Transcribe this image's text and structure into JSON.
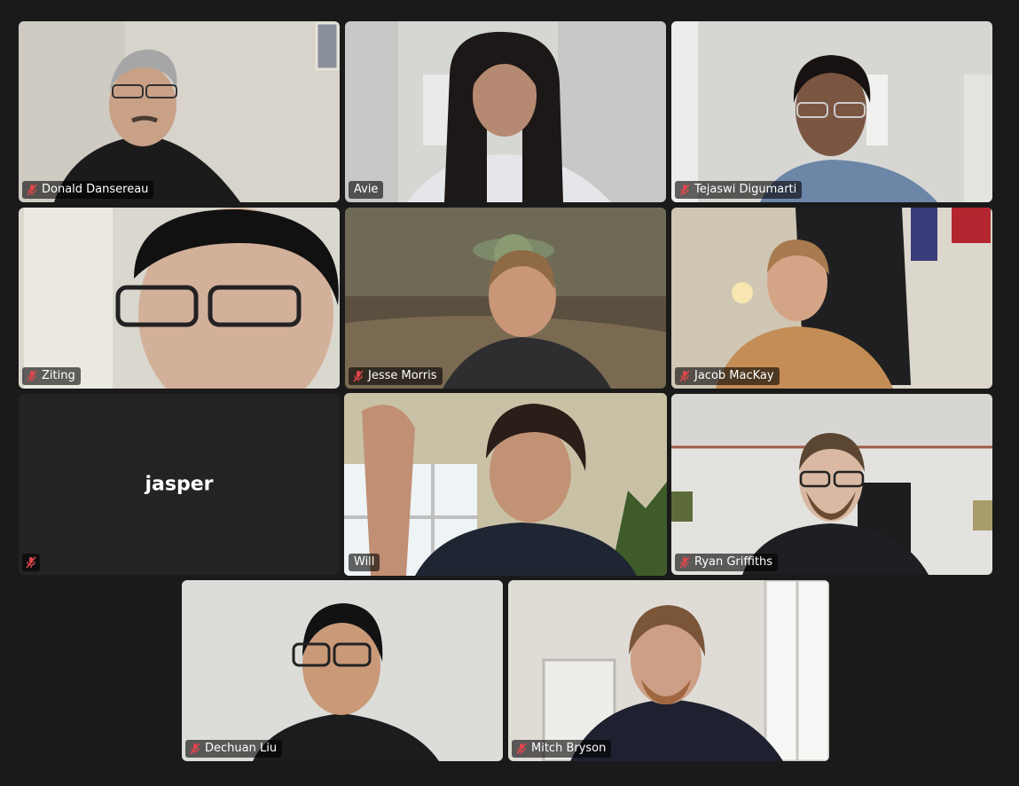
{
  "meeting": {
    "participants": [
      {
        "name": "Donald Dansereau",
        "muted": true,
        "video": true,
        "active": false
      },
      {
        "name": "Avie",
        "muted": false,
        "video": true,
        "active": false
      },
      {
        "name": "Tejaswi Digumarti",
        "muted": true,
        "video": true,
        "active": false
      },
      {
        "name": "Ziting",
        "muted": true,
        "video": true,
        "active": false
      },
      {
        "name": "Jesse Morris",
        "muted": true,
        "video": true,
        "active": false
      },
      {
        "name": "Jacob MacKay",
        "muted": true,
        "video": true,
        "active": false
      },
      {
        "name": "jasper",
        "muted": true,
        "video": false,
        "active": false
      },
      {
        "name": "Will",
        "muted": false,
        "video": true,
        "active": true
      },
      {
        "name": "Ryan Griffiths",
        "muted": true,
        "video": true,
        "active": false
      },
      {
        "name": "Dechuan Liu",
        "muted": true,
        "video": true,
        "active": false
      },
      {
        "name": "Mitch Bryson",
        "muted": true,
        "video": true,
        "active": false
      }
    ]
  },
  "colors": {
    "background": "#1a1a1a",
    "active_speaker_border": "#3ccf4e",
    "muted_icon": "#e0474c"
  },
  "icons": {
    "muted": "microphone-muted-icon"
  }
}
